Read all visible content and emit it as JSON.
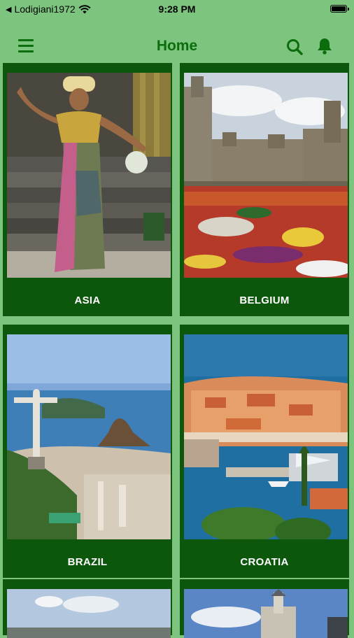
{
  "status": {
    "carrier": "Lodigiani1972",
    "time": "9:28 PM"
  },
  "header": {
    "title": "Home"
  },
  "cards": [
    {
      "label": "ASIA"
    },
    {
      "label": "BELGIUM"
    },
    {
      "label": "BRAZIL"
    },
    {
      "label": "CROATIA"
    },
    {
      "label": ""
    },
    {
      "label": ""
    }
  ]
}
